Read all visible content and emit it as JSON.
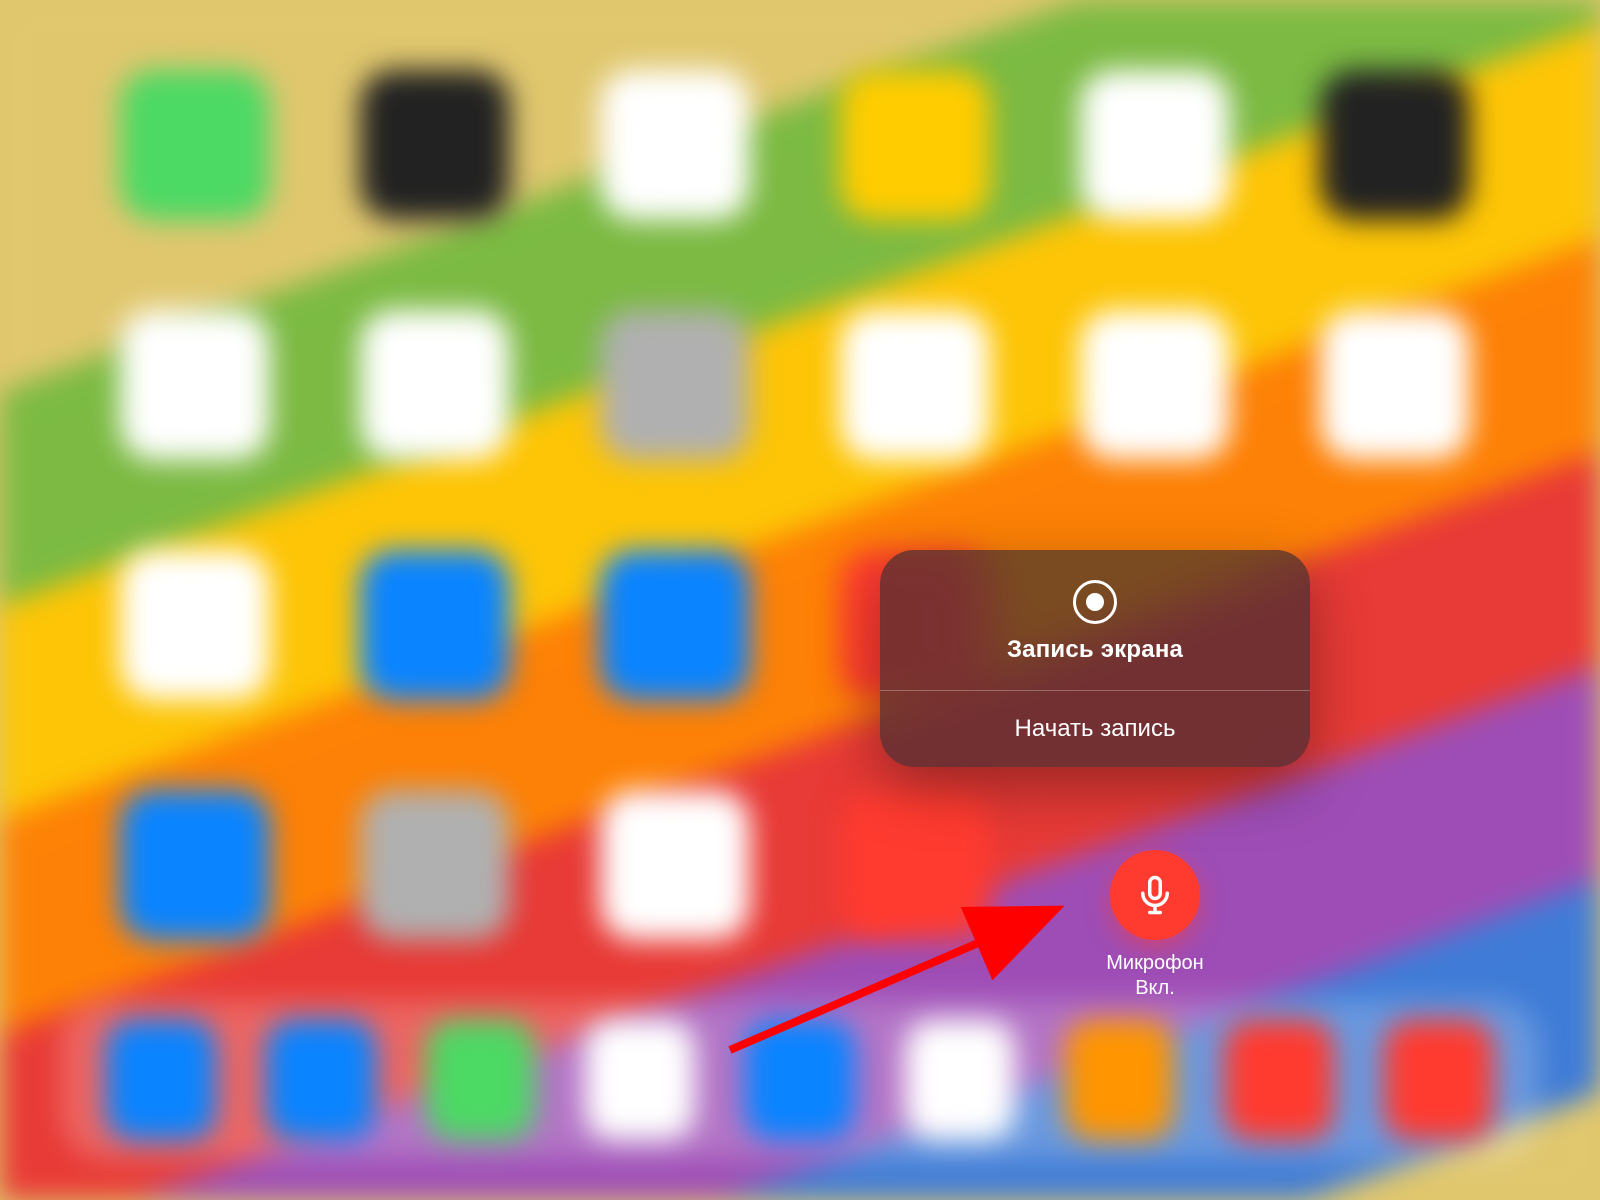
{
  "panel": {
    "title": "Запись экрана",
    "start_label": "Начать запись",
    "icon": "record-icon"
  },
  "microphone": {
    "label": "Микрофон",
    "state": "Вкл.",
    "icon": "microphone-icon",
    "color": "#ff3b30"
  },
  "annotation": {
    "type": "arrow",
    "color": "#ff0000",
    "target": "microphone-toggle"
  },
  "background": {
    "kind": "ipad-home-screen-blurred",
    "wallpaper": "rainbow-stripes"
  }
}
